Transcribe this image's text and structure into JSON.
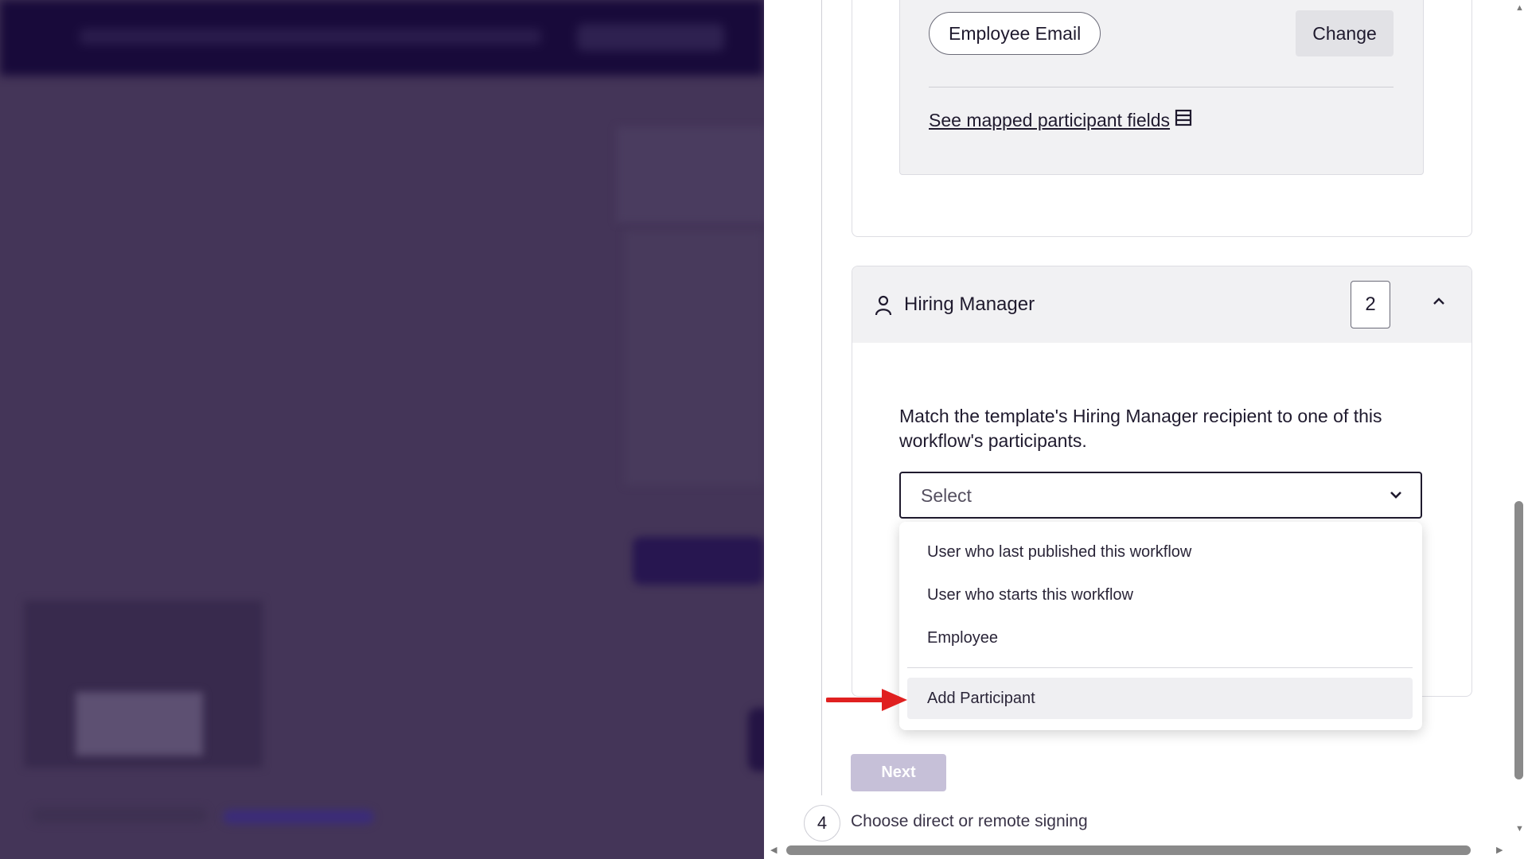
{
  "participant_card": {
    "field_pill": "Employee Email",
    "change_label": "Change",
    "mapped_link": "See mapped participant fields"
  },
  "hiring_manager": {
    "title": "Hiring Manager",
    "count": "2",
    "instruction": "Match the template's Hiring Manager recipient to one of this workflow's participants.",
    "select_placeholder": "Select",
    "options": [
      "User who last published this workflow",
      "User who starts this workflow",
      "Employee"
    ],
    "add_participant": "Add Participant"
  },
  "next_label": "Next",
  "next_step": {
    "number": "4",
    "label": "Choose direct or remote signing"
  },
  "colors": {
    "overlay": "#443558",
    "topbar": "#180a3a",
    "next_disabled": "#c6c0d8",
    "arrow": "#e02020"
  }
}
